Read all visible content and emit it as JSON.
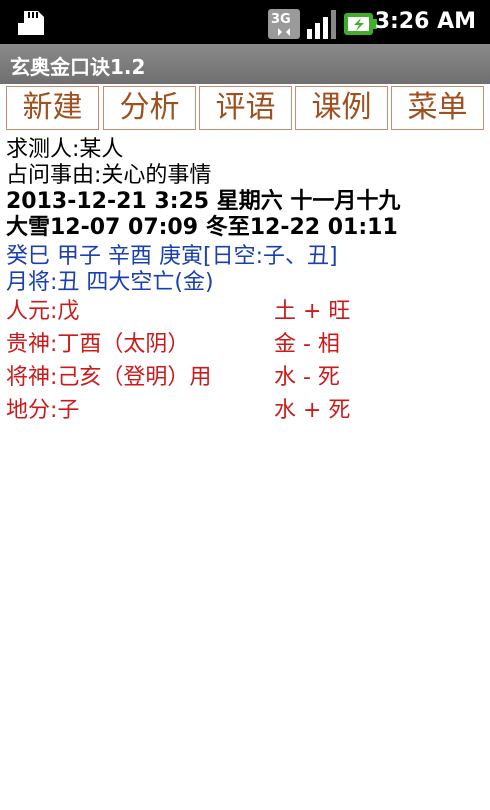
{
  "status_bar": {
    "network": "3G",
    "time": "3:26 AM",
    "icons": [
      "sd-card-icon",
      "3g-icon",
      "signal-icon",
      "battery-charging-icon"
    ]
  },
  "app": {
    "title": "玄奥金口诀1.2"
  },
  "menu": {
    "items": [
      "新建",
      "分析",
      "评语",
      "课例",
      "菜单"
    ]
  },
  "content": {
    "inquirer": "求测人:某人",
    "matter": "占问事由:关心的事情",
    "datetime": "2013-12-21 3:25  星期六 十一月十九",
    "solar_terms": "大雪12-07 07:09 冬至12-22 01:11",
    "ganzhi": "癸巳 甲子 辛酉 庚寅[日空:子、丑]",
    "yuejiang": "月将:丑   四大空亡(金)",
    "rows": [
      {
        "left": "人元:戊",
        "right": "土 + 旺"
      },
      {
        "left": "贵神:丁酉（太阴）",
        "right": "金 - 相"
      },
      {
        "left": "将神:己亥（登明）用",
        "right": "水 - 死"
      },
      {
        "left": "地分:子",
        "right": "水 + 死"
      }
    ]
  },
  "colors": {
    "menu_text": "#a0501f",
    "blue_text": "#1a3fb0",
    "red_text": "#cc1a1a"
  }
}
